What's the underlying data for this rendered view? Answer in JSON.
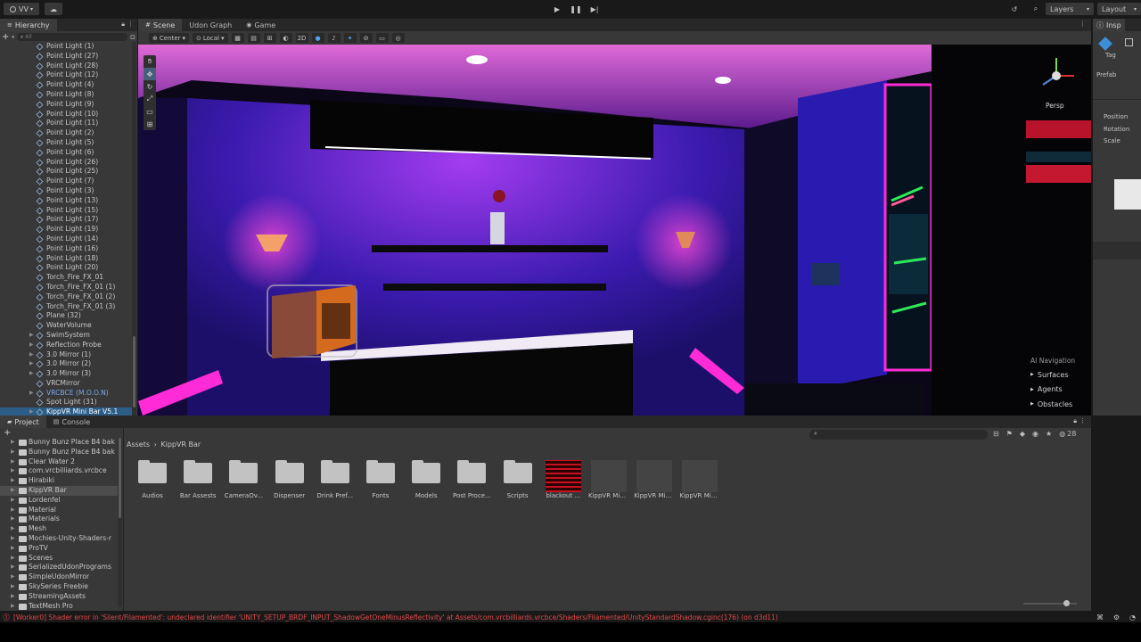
{
  "toolbar": {
    "account": "VV",
    "layers": "Layers",
    "layout": "Layout"
  },
  "hierarchy": {
    "tab": "Hierarchy",
    "search_placeholder": "All",
    "items": [
      {
        "label": "Point Light (1)"
      },
      {
        "label": "Point Light (27)"
      },
      {
        "label": "Point Light (28)"
      },
      {
        "label": "Point Light (12)"
      },
      {
        "label": "Point Light (4)"
      },
      {
        "label": "Point Light (8)"
      },
      {
        "label": "Point Light (9)"
      },
      {
        "label": "Point Light (10)"
      },
      {
        "label": "Point Light (11)"
      },
      {
        "label": "Point Light (2)"
      },
      {
        "label": "Point Light (5)"
      },
      {
        "label": "Point Light (6)"
      },
      {
        "label": "Point Light (26)"
      },
      {
        "label": "Point Light (25)"
      },
      {
        "label": "Point Light (7)"
      },
      {
        "label": "Point Light (3)"
      },
      {
        "label": "Point Light (13)"
      },
      {
        "label": "Point Light (15)"
      },
      {
        "label": "Point Light (17)"
      },
      {
        "label": "Point Light (19)"
      },
      {
        "label": "Point Light (14)"
      },
      {
        "label": "Point Light (16)"
      },
      {
        "label": "Point Light (18)"
      },
      {
        "label": "Point Light (20)"
      },
      {
        "label": "Torch_Fire_FX_01"
      },
      {
        "label": "Torch_Fire_FX_01 (1)"
      },
      {
        "label": "Torch_Fire_FX_01 (2)"
      },
      {
        "label": "Torch_Fire_FX_01 (3)"
      },
      {
        "label": "Plane (32)"
      },
      {
        "label": "WaterVolume"
      },
      {
        "label": "SwimSystem"
      },
      {
        "label": "Reflection Probe"
      },
      {
        "label": "3.0 Mirror (1)"
      },
      {
        "label": "3.0 Mirror (2)"
      },
      {
        "label": "3.0 Mirror (3)"
      },
      {
        "label": "VRCMirror"
      },
      {
        "label": "VRCBCE (M.O.O.N)"
      },
      {
        "label": "Spot Light (31)"
      },
      {
        "label": "KippVR Mini Bar V5.1"
      }
    ]
  },
  "scene": {
    "tabs": [
      "Scene",
      "Udon Graph",
      "Game"
    ],
    "pivot": "Center",
    "space": "Local",
    "mode_2d": "2D",
    "persp": "Persp",
    "nav_title": "AI Navigation",
    "nav_items": [
      "Surfaces",
      "Agents",
      "Obstacles"
    ]
  },
  "inspector": {
    "tab": "Insp",
    "labels": [
      "Tag",
      "Prefab",
      "Position",
      "Rotation",
      "Scale"
    ]
  },
  "project": {
    "tabs": [
      "Project",
      "Console"
    ],
    "breadcrumb_root": "Assets",
    "breadcrumb_current": "KippVR Bar",
    "count": "28",
    "tree": [
      {
        "label": "Bunny Bunz Place B4 bak"
      },
      {
        "label": "Bunny Bunz Place B4 bak"
      },
      {
        "label": "Clear Water 2"
      },
      {
        "label": "com.vrcbilliards.vrcbce"
      },
      {
        "label": "Hirabiki"
      },
      {
        "label": "KippVR Bar"
      },
      {
        "label": "Lordenfel"
      },
      {
        "label": "Material"
      },
      {
        "label": "Materials"
      },
      {
        "label": "Mesh"
      },
      {
        "label": "Mochies-Unity-Shaders-r"
      },
      {
        "label": "ProTV"
      },
      {
        "label": "Scenes"
      },
      {
        "label": "SerializedUdonPrograms"
      },
      {
        "label": "SimpleUdonMirror"
      },
      {
        "label": "SkySeries Freebie"
      },
      {
        "label": "StreamingAssets"
      },
      {
        "label": "TextMesh Pro"
      }
    ],
    "assets": [
      {
        "label": "Audios"
      },
      {
        "label": "Bar Assests"
      },
      {
        "label": "CameraOv..."
      },
      {
        "label": "Dispenser"
      },
      {
        "label": "Drink Pref..."
      },
      {
        "label": "Fonts"
      },
      {
        "label": "Models"
      },
      {
        "label": "Post Proce..."
      },
      {
        "label": "Scripts"
      },
      {
        "label": "blackout ..."
      },
      {
        "label": "KippVR Min..."
      },
      {
        "label": "KippVR Min..."
      },
      {
        "label": "KippVR Min..."
      }
    ]
  },
  "console": {
    "message": "[Worker0] Shader error in 'Silent/Filamented': undeclared identifier 'UNITY_SETUP_BRDF_INPUT_ShadowGetOneMinusReflectivity' at Assets/com.vrcbilliards.vrcbce/Shaders/Filamented/UnityStandardShadow.cginc(176) (on d3d11)"
  },
  "colors": {
    "accent": "#2c5d87",
    "error": "#e04a4a",
    "neon_pink": "#ff2bd6",
    "wall_purple": "#3a1aa0"
  }
}
